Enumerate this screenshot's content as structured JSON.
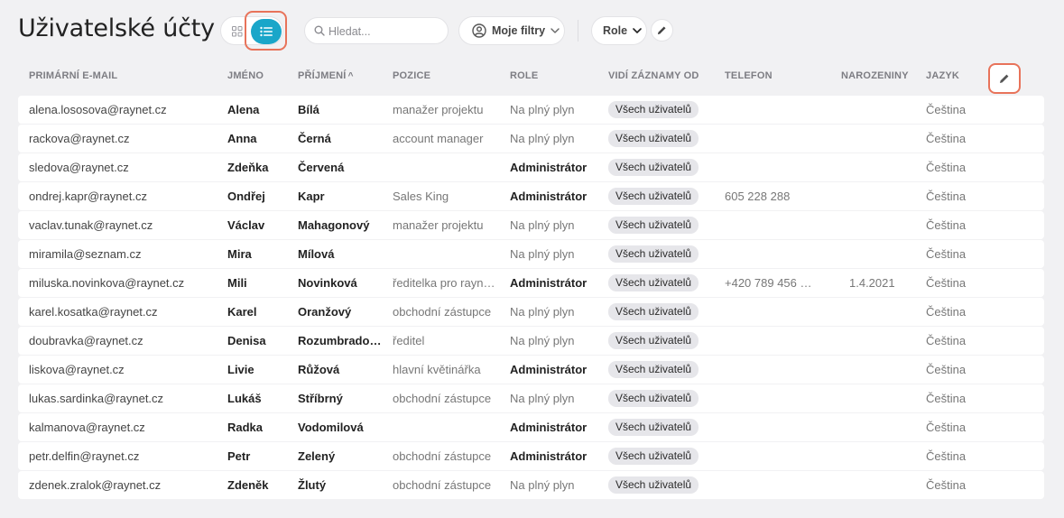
{
  "page": {
    "title": "Uživatelské účty"
  },
  "toolbar": {
    "search_placeholder": "Hledat...",
    "filters_label": "Moje filtry",
    "role_label": "Role",
    "accent": "#1aa6c9",
    "highlight": "#e8735a"
  },
  "table": {
    "headers": {
      "email": "PRIMÁRNÍ E-MAIL",
      "first": "JMÉNO",
      "last": "PŘÍJMENÍ",
      "last_sort": "^",
      "position": "POZICE",
      "role": "ROLE",
      "visibility": "VIDÍ ZÁZNAMY OD",
      "phone": "TELEFON",
      "birthday": "NAROZENINY",
      "language": "JAZYK"
    },
    "rows": [
      {
        "email": "alena.lososova@raynet.cz",
        "first": "Alena",
        "last": "Bílá",
        "position": "manažer projektu",
        "role": "Na plný plyn",
        "admin": false,
        "visibility": "Všech uživatelů",
        "phone": "",
        "birthday": "",
        "language": "Čeština"
      },
      {
        "email": "rackova@raynet.cz",
        "first": "Anna",
        "last": "Černá",
        "position": "account manager",
        "role": "Na plný plyn",
        "admin": false,
        "visibility": "Všech uživatelů",
        "phone": "",
        "birthday": "",
        "language": "Čeština"
      },
      {
        "email": "sledova@raynet.cz",
        "first": "Zdeňka",
        "last": "Červená",
        "position": "",
        "role": "Administrátor",
        "admin": true,
        "visibility": "Všech uživatelů",
        "phone": "",
        "birthday": "",
        "language": "Čeština"
      },
      {
        "email": "ondrej.kapr@raynet.cz",
        "first": "Ondřej",
        "last": "Kapr",
        "position": "Sales King",
        "role": "Administrátor",
        "admin": true,
        "visibility": "Všech uživatelů",
        "phone": "605 228 288",
        "birthday": "",
        "language": "Čeština"
      },
      {
        "email": "vaclav.tunak@raynet.cz",
        "first": "Václav",
        "last": "Mahagonový",
        "position": "manažer projektu",
        "role": "Na plný plyn",
        "admin": false,
        "visibility": "Všech uživatelů",
        "phone": "",
        "birthday": "",
        "language": "Čeština"
      },
      {
        "email": "miramila@seznam.cz",
        "first": "Mira",
        "last": "Mílová",
        "position": "",
        "role": "Na plný plyn",
        "admin": false,
        "visibility": "Všech uživatelů",
        "phone": "",
        "birthday": "",
        "language": "Čeština"
      },
      {
        "email": "miluska.novinkova@raynet.cz",
        "first": "Mili",
        "last": "Novinková",
        "position": "ředitelka pro rayn…",
        "role": "Administrátor",
        "admin": true,
        "visibility": "Všech uživatelů",
        "phone": "+420 789 456 1…",
        "birthday": "1.4.2021",
        "language": "Čeština"
      },
      {
        "email": "karel.kosatka@raynet.cz",
        "first": "Karel",
        "last": "Oranžový",
        "position": "obchodní zástupce",
        "role": "Na plný plyn",
        "admin": false,
        "visibility": "Všech uživatelů",
        "phone": "",
        "birthday": "",
        "language": "Čeština"
      },
      {
        "email": "doubravka@raynet.cz",
        "first": "Denisa",
        "last": "Rozumbrado…",
        "position": "ředitel",
        "role": "Na plný plyn",
        "admin": false,
        "visibility": "Všech uživatelů",
        "phone": "",
        "birthday": "",
        "language": "Čeština"
      },
      {
        "email": "liskova@raynet.cz",
        "first": "Livie",
        "last": "Růžová",
        "position": "hlavní květinářka",
        "role": "Administrátor",
        "admin": true,
        "visibility": "Všech uživatelů",
        "phone": "",
        "birthday": "",
        "language": "Čeština"
      },
      {
        "email": "lukas.sardinka@raynet.cz",
        "first": "Lukáš",
        "last": "Stříbrný",
        "position": "obchodní zástupce",
        "role": "Na plný plyn",
        "admin": false,
        "visibility": "Všech uživatelů",
        "phone": "",
        "birthday": "",
        "language": "Čeština"
      },
      {
        "email": "kalmanova@raynet.cz",
        "first": "Radka",
        "last": "Vodomilová",
        "position": "",
        "role": "Administrátor",
        "admin": true,
        "visibility": "Všech uživatelů",
        "phone": "",
        "birthday": "",
        "language": "Čeština"
      },
      {
        "email": "petr.delfin@raynet.cz",
        "first": "Petr",
        "last": "Zelený",
        "position": "obchodní zástupce",
        "role": "Administrátor",
        "admin": true,
        "visibility": "Všech uživatelů",
        "phone": "",
        "birthday": "",
        "language": "Čeština"
      },
      {
        "email": "zdenek.zralok@raynet.cz",
        "first": "Zdeněk",
        "last": "Žlutý",
        "position": "obchodní zástupce",
        "role": "Na plný plyn",
        "admin": false,
        "visibility": "Všech uživatelů",
        "phone": "",
        "birthday": "",
        "language": "Čeština"
      }
    ]
  },
  "icons": {
    "grid": "grid-view-icon",
    "list": "list-view-icon",
    "search": "search-icon",
    "filter": "user-circle-icon",
    "chevron": "chevron-down-icon",
    "edit": "pencil-icon"
  }
}
